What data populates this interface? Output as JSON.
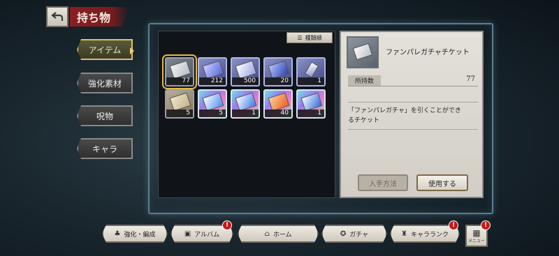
{
  "header": {
    "title": "持ち物",
    "back_icon": "back-arrow-icon"
  },
  "side_nav": {
    "items": [
      {
        "label": "アイテム",
        "active": true
      },
      {
        "label": "強化素材",
        "active": false
      },
      {
        "label": "呪物",
        "active": false
      },
      {
        "label": "キャラ",
        "active": false
      }
    ]
  },
  "sort": {
    "label": "種類順",
    "icon": "sort-icon"
  },
  "items": [
    {
      "count": "77",
      "rarity": "gray",
      "selected": true
    },
    {
      "count": "212",
      "rarity": "blue"
    },
    {
      "count": "500",
      "rarity": "blue"
    },
    {
      "count": "20",
      "rarity": "blue"
    },
    {
      "count": "1",
      "rarity": "blue"
    },
    {
      "count": "5",
      "rarity": "tan"
    },
    {
      "count": "5",
      "rarity": "rainbow"
    },
    {
      "count": "1",
      "rarity": "rainbow"
    },
    {
      "count": "40",
      "rarity": "rainbow"
    },
    {
      "count": "1",
      "rarity": "rainbow"
    }
  ],
  "detail": {
    "name": "ファンパレガチャチケット",
    "count_label": "所持数",
    "count_value": "77",
    "description_line1": "「ファンパレガチャ」を引くことができ",
    "description_line2": "るチケット",
    "obtain_label": "入手方法",
    "use_label": "使用する"
  },
  "bottom_nav": {
    "items": [
      {
        "label": "強化・編成",
        "icon": "character-icon",
        "badge": false
      },
      {
        "label": "アルバム",
        "icon": "album-icon",
        "badge": true
      },
      {
        "label": "ホーム",
        "icon": "home-icon",
        "badge": false
      },
      {
        "label": "ガチャ",
        "icon": "gacha-icon",
        "badge": false
      },
      {
        "label": "キャラランク",
        "icon": "rank-icon",
        "badge": true
      }
    ],
    "menu_label": "メニュー",
    "badge_symbol": "!"
  },
  "colors": {
    "accent_red": "#8a1e22",
    "badge_red": "#c41818",
    "selected_gold": "#e6b84a"
  }
}
